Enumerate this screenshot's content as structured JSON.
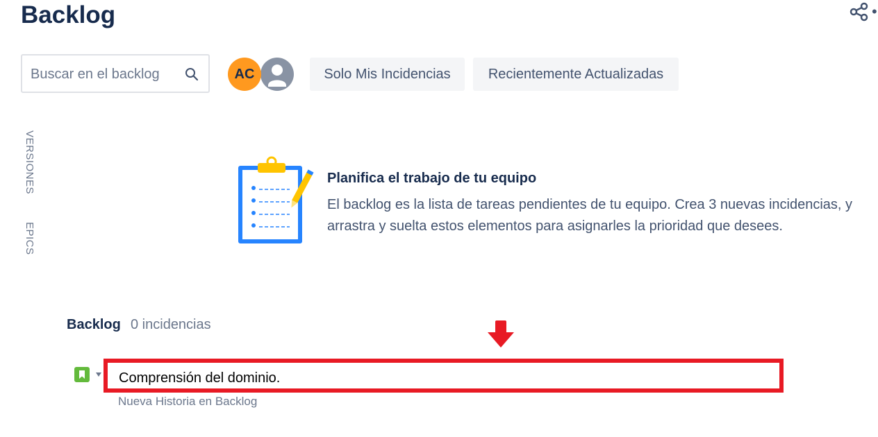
{
  "header": {
    "title": "Backlog",
    "share_icon": "share-icon",
    "more_glyph": "•"
  },
  "toolbar": {
    "search": {
      "placeholder": "Buscar en el backlog",
      "value": "",
      "icon": "search-icon"
    },
    "avatars": [
      {
        "initials": "AC",
        "color": "#ff991f"
      },
      {
        "initials": "",
        "icon": "user-avatar-icon",
        "color": "#8993a4"
      }
    ],
    "quick_filters": [
      {
        "label": "Solo Mis Incidencias"
      },
      {
        "label": "Recientemente Actualizadas"
      }
    ]
  },
  "side_tabs": {
    "versions": "VERSIONES",
    "epics": "EPICS"
  },
  "empty_state": {
    "icon": "clipboard-checklist-icon",
    "title": "Planifica el trabajo de tu equipo",
    "description": "El backlog es la lista de tareas pendientes de tu equipo. Crea 3 nuevas incidencias, y arrastra y suelta estos elementos para asignarles la prioridad que desees."
  },
  "backlog": {
    "title": "Backlog",
    "count": "0 incidencias",
    "new_issue": {
      "type_icon": "story-icon",
      "value": "Comprensión del dominio.",
      "helper": "Nueva Historia en Backlog"
    }
  },
  "annotations": {
    "arrow": "red-down-arrow-icon",
    "highlight_color": "#e81a24"
  },
  "colors": {
    "text_primary": "#172b4d",
    "text_secondary": "#42526e",
    "text_subtle": "#6b778c",
    "button_bg": "#f4f5f7",
    "story_green": "#63ba3c",
    "illustration_blue": "#2684ff",
    "illustration_yellow": "#ffc400"
  }
}
